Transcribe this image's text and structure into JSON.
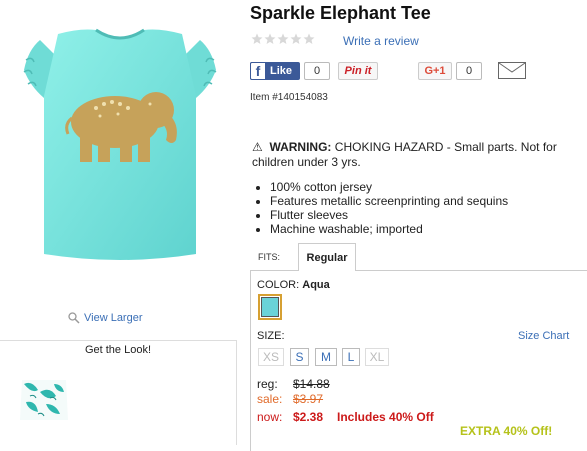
{
  "product": {
    "title": "Sparkle Elephant Tee",
    "item_number": "Item #140154083",
    "rating_stars": 0
  },
  "links": {
    "write_review": "Write a review",
    "view_larger": "View Larger",
    "size_chart": "Size Chart"
  },
  "social": {
    "fb_label": "Like",
    "fb_count": "0",
    "pin_label": "Pin it",
    "gplus_label": "G+1",
    "gplus_count": "0"
  },
  "warning": {
    "label": "WARNING:",
    "text": "CHOKING HAZARD - Small parts. Not for children under 3 yrs."
  },
  "features": [
    "100% cotton jersey",
    "Features metallic screenprinting and sequins",
    "Flutter sleeves",
    "Machine washable; imported"
  ],
  "fits": {
    "label": "FITS:",
    "selected_tab": "Regular"
  },
  "color": {
    "label": "COLOR:",
    "value": "Aqua",
    "swatch_hex": "#6ad3d8"
  },
  "size": {
    "label": "SIZE:",
    "options": [
      {
        "label": "XS",
        "available": false
      },
      {
        "label": "S",
        "available": true
      },
      {
        "label": "M",
        "available": true
      },
      {
        "label": "L",
        "available": true
      },
      {
        "label": "XL",
        "available": false
      }
    ]
  },
  "pricing": {
    "reg_label": "reg:",
    "reg_price": "$14.88",
    "sale_label": "sale:",
    "sale_price": "$3.97",
    "now_label": "now:",
    "now_price": "$2.38",
    "now_note": "Includes 40% Off",
    "promo": "EXTRA 40% Off!"
  },
  "get_the_look": {
    "title": "Get the Look!"
  },
  "colors": {
    "link_blue": "#3b6fb6",
    "price_red": "#cc1a1a",
    "sale_orange": "#e06a2a",
    "promo_green": "#b5c21a",
    "tee_aqua": "#78e2dc"
  }
}
